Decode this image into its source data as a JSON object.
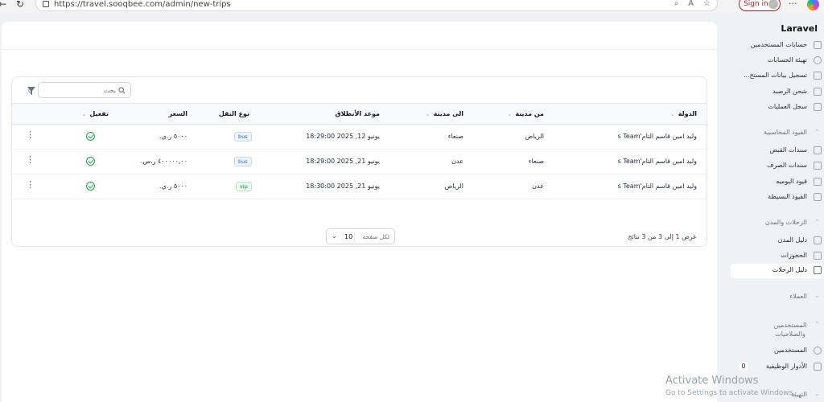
{
  "browser": {
    "url": "https://travel.sooqbee.com/admin/new-trips",
    "signin_label": "Sign in",
    "more_label": "···"
  },
  "search": {
    "placeholder": "بحث"
  },
  "filter": {
    "badge": "0"
  },
  "table": {
    "columns": [
      "الدولة",
      "من مدينة",
      "الى مدينة",
      "موعد الأنطلاق",
      "نوع النقل",
      "السعر",
      "تفعيل"
    ],
    "rows": [
      {
        "country": "وليد امين قاسم التام's Team",
        "from_city": "الرياض",
        "to_city": "صنعاء",
        "departure": "يونيو 12, 2025 18:29:00",
        "transport": "bus",
        "price": "٥٠٠٠ ر.ي.",
        "active": true
      },
      {
        "country": "وليد امين قاسم التام's Team",
        "from_city": "صنعاء",
        "to_city": "عدن",
        "departure": "يونيو 21, 2025 18:29:00",
        "transport": "bus",
        "price": "٤٠٠٠٠٠,٠٠ ر.س.",
        "active": true
      },
      {
        "country": "وليد امين قاسم التام's Team",
        "from_city": "عدن",
        "to_city": "الرياض",
        "departure": "يونيو 21, 2025 18:30:00",
        "transport": "vip",
        "price": "٥٠٠٠ ر.ي.",
        "active": true
      }
    ],
    "summary": "عرض 1 إلى 3 من 3 نتائج",
    "per_page_label": "لكل صفحة",
    "per_page_value": "10"
  },
  "sidebar": {
    "brand": "Laravel",
    "items_top": [
      "حسابات المستخدمين",
      "تهيئة الحسابات",
      "تسجيل بيانات المستخ...",
      "شحن الرصيد",
      "سجل العمليات"
    ],
    "group_accounting": {
      "title": "القيود المحاسبية",
      "items": [
        "سندات القبض",
        "سندات الصرف",
        "قيود اليوميه",
        "القيود البسيطة"
      ]
    },
    "group_trips": {
      "title": "الرحلات والمدن",
      "items": [
        "دليل المدن",
        "الحجوزات",
        "دليل الرحلات"
      ]
    },
    "group_clients": {
      "title": "العملاء"
    },
    "group_users": {
      "title": "المستخدمين والصلاحيات",
      "items": [
        "المستخدمين",
        "الأدوار الوظيفية"
      ],
      "roles_count": "0"
    },
    "group_setup": {
      "title": "التهيئة"
    }
  },
  "watermark": {
    "line1": "Activate Windows",
    "line2": "Go to Settings to activate Windows."
  }
}
